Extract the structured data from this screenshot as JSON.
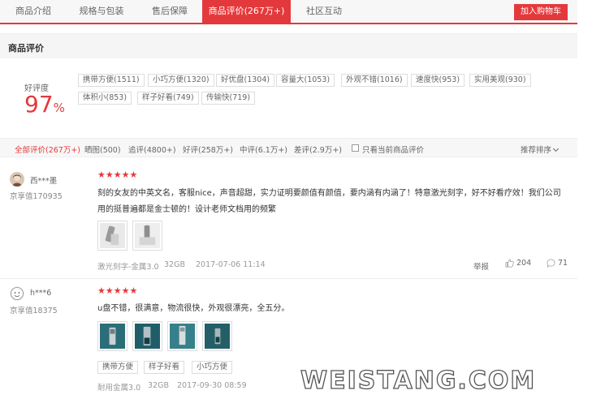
{
  "tabs": [
    {
      "label": "商品介绍"
    },
    {
      "label": "规格与包装"
    },
    {
      "label": "售后保障"
    },
    {
      "label": "商品评价(267万+)"
    },
    {
      "label": "社区互动"
    }
  ],
  "cart_button": "加入购物车",
  "section_title": "商品评价",
  "rating": {
    "label": "好评度",
    "value": "97",
    "unit": "%"
  },
  "tags": [
    "携带方便(1511)",
    "小巧方便(1320)",
    "好优盘(1304)",
    "容量大(1053)",
    "外观不错(1016)",
    "速度快(953)",
    "实用美观(930)",
    "体积小(853)",
    "样子好看(749)",
    "传输快(719)"
  ],
  "filters": {
    "all": "全部评价(267万+)",
    "pics": "晒图(500)",
    "followup": "追评(4800+)",
    "good": "好评(258万+)",
    "neutral": "中评(6.1万+)",
    "bad": "差评(2.9万+)",
    "current_only": "只看当前商品评价",
    "sort": "推荐排序"
  },
  "reviews": [
    {
      "user": "西***墨",
      "level": "京享值170935",
      "stars": "★★★★★",
      "text": "刻的女友的中英文名，客服nice，声音超甜，实力证明要颜值有颜值，要内涵有内涵了！特意激光刻字，好不好看疗效！我们公司用的挺普遍都是金士顿的！设计老师文档用的频繁",
      "spec": "激光刻字-金属3.0",
      "capacity": "32GB",
      "date": "2017-07-06 11:14",
      "report": "举报",
      "likes": "204",
      "comments": "71"
    },
    {
      "user": "h***6",
      "level": "京享值18375",
      "stars": "★★★★★",
      "text": "u盘不错，很满意，物流很快，外观很漂亮，全五分。",
      "tags": [
        "携带方便",
        "样子好看",
        "小巧方便"
      ],
      "spec": "耐用金属3.0",
      "capacity": "32GB",
      "date": "2017-09-30 08:59"
    }
  ],
  "watermark": "WEISTANG.COM",
  "colors": {
    "accent": "#e4393c"
  }
}
